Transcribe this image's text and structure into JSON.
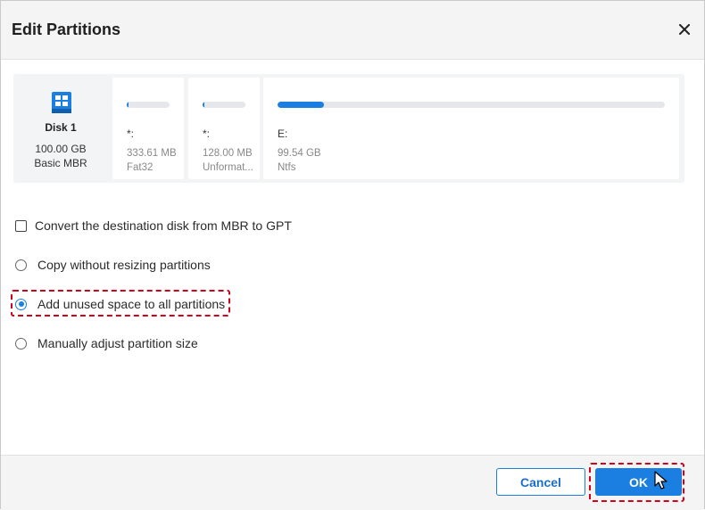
{
  "dialog": {
    "title": "Edit Partitions",
    "close_icon": "close-icon"
  },
  "disk": {
    "icon": "disk-icon",
    "name": "Disk 1",
    "size": "100.00 GB",
    "type": "Basic MBR",
    "partitions": [
      {
        "letter": "*:",
        "size": "333.61 MB",
        "fs": "Fat32",
        "usage_fraction": 0.05
      },
      {
        "letter": "*:",
        "size": "128.00 MB",
        "fs": "Unformat...",
        "usage_fraction": 0.05
      },
      {
        "letter": "E:",
        "size": "99.54 GB",
        "fs": "Ntfs",
        "usage_fraction": 0.12
      }
    ]
  },
  "options": {
    "convert_label": "Convert the destination disk from MBR to GPT",
    "convert_checked": false,
    "radio": [
      {
        "label": "Copy without resizing partitions",
        "checked": false
      },
      {
        "label": "Add unused space to all partitions",
        "checked": true
      },
      {
        "label": "Manually adjust partition size",
        "checked": false
      }
    ]
  },
  "footer": {
    "cancel_label": "Cancel",
    "ok_label": "OK"
  },
  "colors": {
    "accent": "#1a7fe0",
    "highlight": "#d0021b"
  }
}
